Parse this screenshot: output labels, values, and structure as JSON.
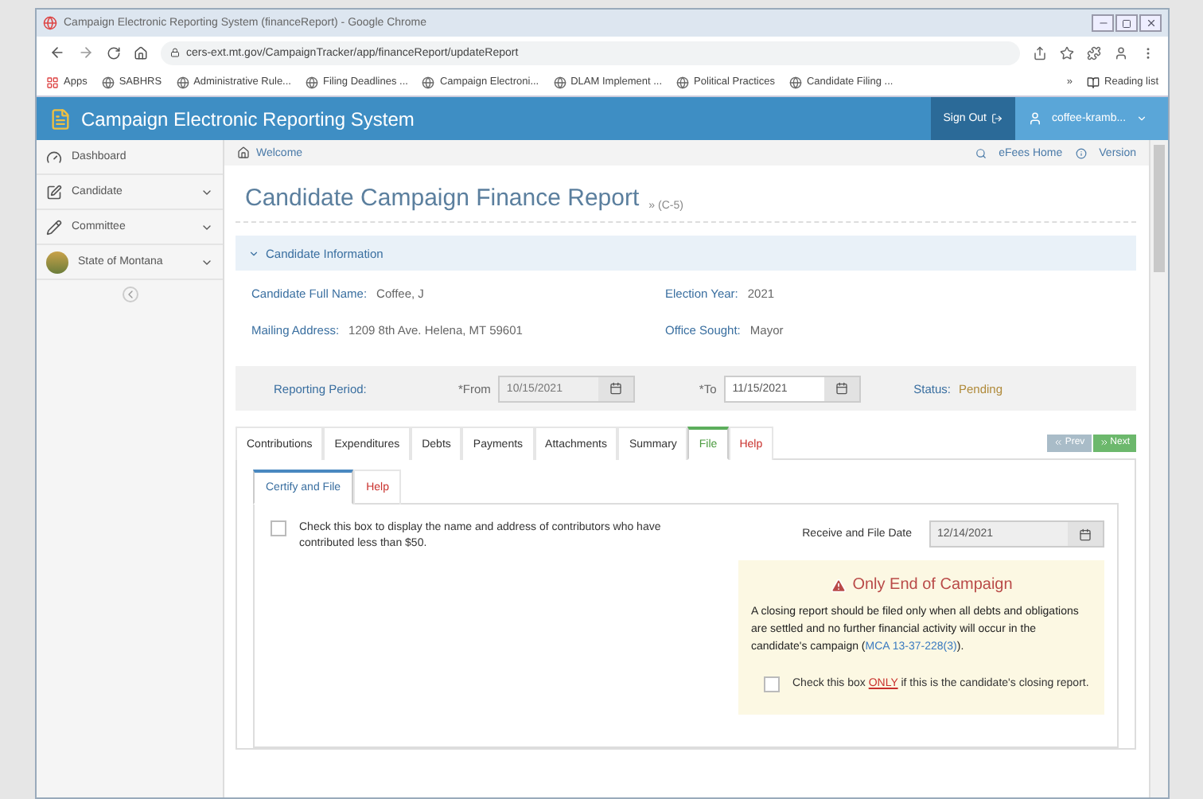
{
  "browser": {
    "title": "Campaign Electronic Reporting System (financeReport) - Google Chrome",
    "url": "cers-ext.mt.gov/CampaignTracker/app/financeReport/updateReport",
    "bookmarks": [
      {
        "label": "Apps"
      },
      {
        "label": "SABHRS"
      },
      {
        "label": "Administrative Rule..."
      },
      {
        "label": "Filing Deadlines ..."
      },
      {
        "label": "Campaign Electroni..."
      },
      {
        "label": "DLAM Implement ..."
      },
      {
        "label": "Political Practices"
      },
      {
        "label": "Candidate Filing ..."
      }
    ],
    "overflow": "»",
    "reading_list": "Reading list"
  },
  "app": {
    "name": "Campaign Electronic Reporting System",
    "sign_out": "Sign Out",
    "user": "coffee-kramb..."
  },
  "sidebar": {
    "items": [
      {
        "label": "Dashboard",
        "has_submenu": false
      },
      {
        "label": "Candidate",
        "has_submenu": true
      },
      {
        "label": "Committee",
        "has_submenu": true
      },
      {
        "label": "State of Montana",
        "has_submenu": true
      }
    ]
  },
  "breadcrumb": "Welcome",
  "top_links": [
    "eFees Home",
    "Version"
  ],
  "heading": "Candidate Campaign Finance Report",
  "form_code": "» (C-5)",
  "candidate_info": {
    "title": "Candidate Information",
    "expanded": true,
    "fields": [
      {
        "label": "Candidate Full Name:",
        "value": "Coffee, J"
      },
      {
        "label": "Election Year:",
        "value": "2021"
      },
      {
        "label": "Mailing Address:",
        "value": "1209 8th Ave. Helena, MT 59601"
      },
      {
        "label": "Office Sought:",
        "value": "Mayor"
      }
    ]
  },
  "period": {
    "label": "Reporting Period:",
    "from_label": "*From",
    "from": "10/15/2021",
    "from_disabled": true,
    "to_label": "*To",
    "to": "11/15/2021",
    "to_disabled": false,
    "status_label": "Status:",
    "status": "Pending"
  },
  "tabs": [
    {
      "label": "Contributions",
      "selected": false,
      "kind": "normal"
    },
    {
      "label": "Expenditures",
      "selected": false,
      "kind": "normal"
    },
    {
      "label": "Debts",
      "selected": false,
      "kind": "normal"
    },
    {
      "label": "Payments",
      "selected": false,
      "kind": "normal"
    },
    {
      "label": "Attachments",
      "selected": false,
      "kind": "normal"
    },
    {
      "label": "Summary",
      "selected": false,
      "kind": "normal"
    },
    {
      "label": "File",
      "selected": true,
      "kind": "normal"
    },
    {
      "label": "Help",
      "selected": false,
      "kind": "help"
    }
  ],
  "nav_buttons": [
    {
      "label": "Prev",
      "disabled": true
    },
    {
      "label": "Next",
      "disabled": false
    }
  ],
  "subtabs": [
    {
      "label": "Certify and File",
      "selected": true,
      "kind": "normal"
    },
    {
      "label": "Help",
      "selected": false,
      "kind": "help"
    }
  ],
  "small_contributors": {
    "text": "Check this box to display the name and address of contributors who have contributed less than $50.",
    "checked": false
  },
  "receive_date": {
    "label": "Receive and File Date",
    "value": "12/14/2021"
  },
  "warning": {
    "title": "Only End of Campaign",
    "text": "A closing report should be filed only when all debts and obligations are settled and no further financial activity will occur in the candidate's campaign (",
    "link": "MCA 13-37-228(3)",
    "text_end": ").",
    "checkbox": {
      "before": "Check this box ",
      "emphasis": "ONLY",
      "after": " if this is the candidate's closing report.",
      "checked": false
    }
  }
}
